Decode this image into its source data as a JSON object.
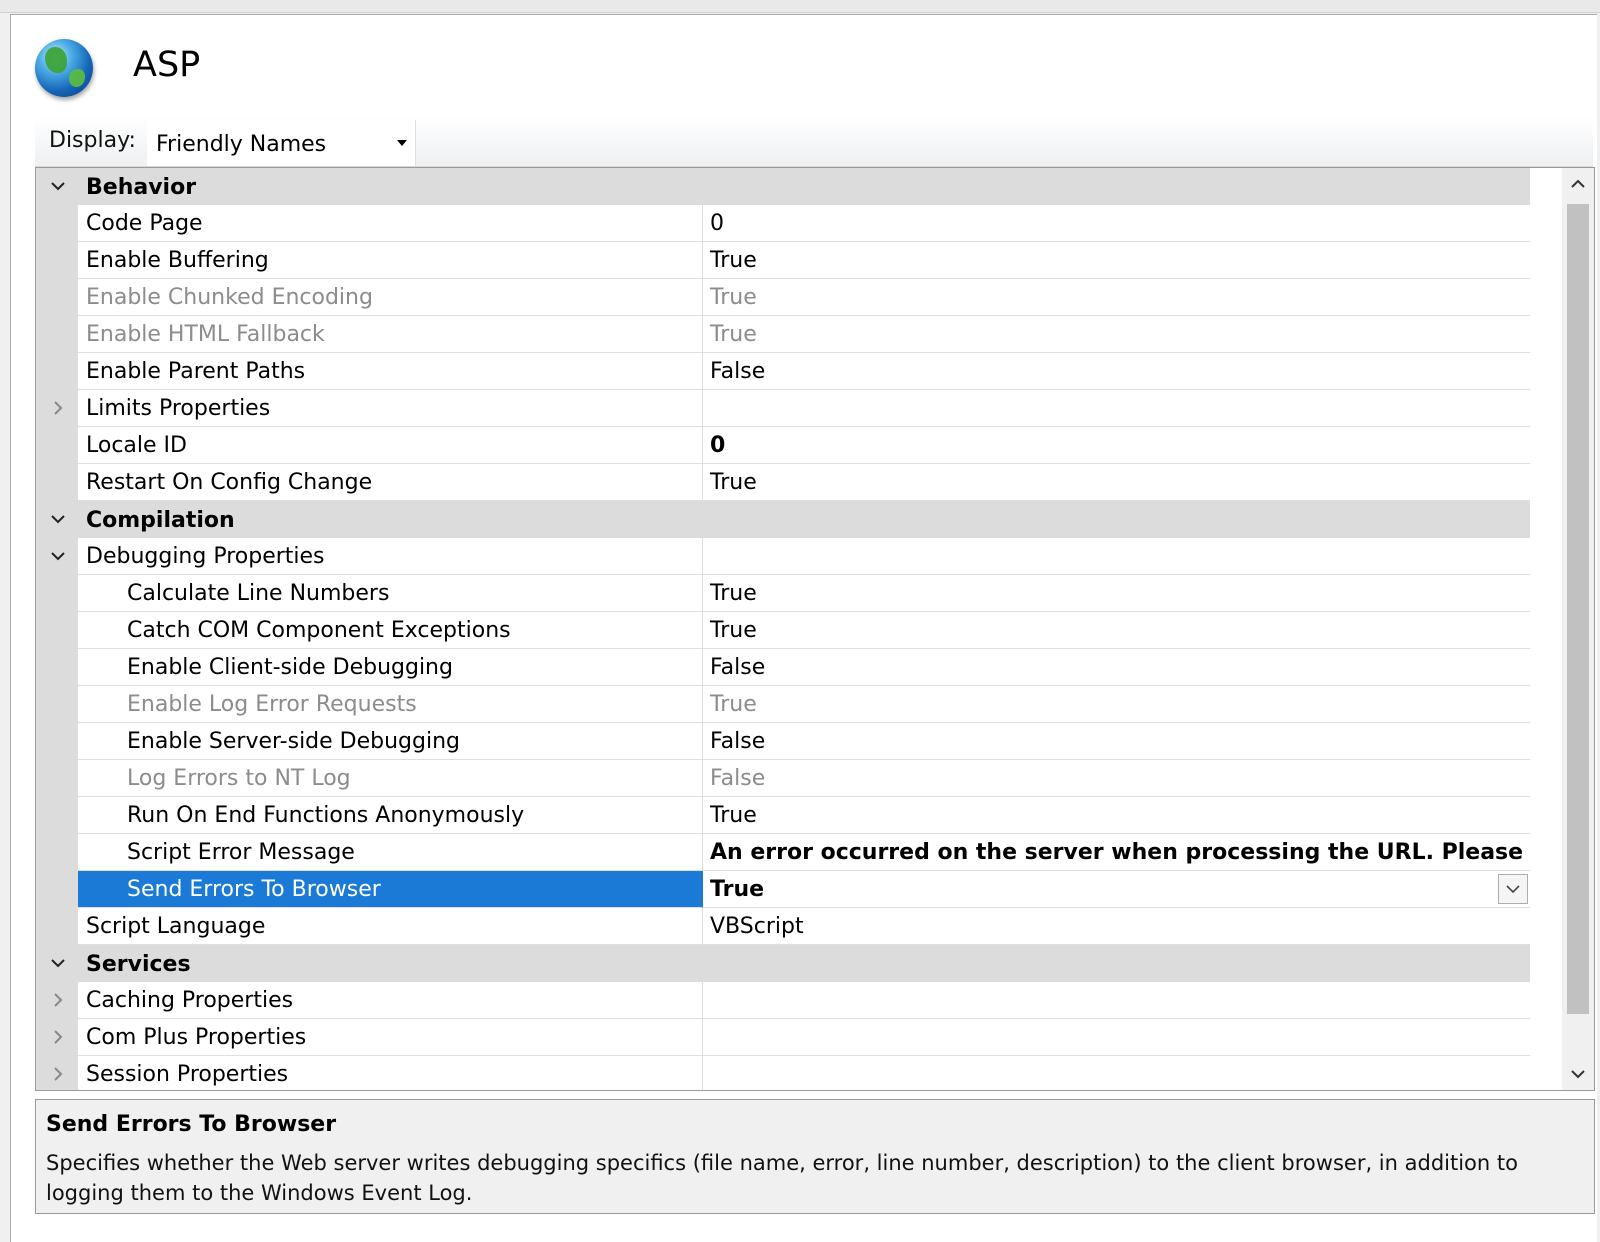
{
  "page": {
    "title": "ASP"
  },
  "toolbar": {
    "display_label": "Display:",
    "display_value": "Friendly Names"
  },
  "grid": {
    "rows": [
      {
        "type": "category",
        "label": "Behavior"
      },
      {
        "type": "property",
        "name": "Code Page",
        "value": "0"
      },
      {
        "type": "property",
        "name": "Enable Buffering",
        "value": "True"
      },
      {
        "type": "property",
        "name": "Enable Chunked Encoding",
        "value": "True",
        "disabled": true
      },
      {
        "type": "property",
        "name": "Enable HTML Fallback",
        "value": "True",
        "disabled": true
      },
      {
        "type": "property",
        "name": "Enable Parent Paths",
        "value": "False"
      },
      {
        "type": "property",
        "name": "Limits Properties",
        "value": "",
        "expandable": "collapsed"
      },
      {
        "type": "property",
        "name": "Locale ID",
        "value": "0",
        "bold": true
      },
      {
        "type": "property",
        "name": "Restart On Config Change",
        "value": "True"
      },
      {
        "type": "category",
        "label": "Compilation"
      },
      {
        "type": "property",
        "name": "Debugging Properties",
        "value": "",
        "expandable": "expanded"
      },
      {
        "type": "property",
        "name": "Calculate Line Numbers",
        "value": "True",
        "indent": 1
      },
      {
        "type": "property",
        "name": "Catch COM Component Exceptions",
        "value": "True",
        "indent": 1
      },
      {
        "type": "property",
        "name": "Enable Client-side Debugging",
        "value": "False",
        "indent": 1
      },
      {
        "type": "property",
        "name": "Enable Log Error Requests",
        "value": "True",
        "indent": 1,
        "disabled": true
      },
      {
        "type": "property",
        "name": "Enable Server-side Debugging",
        "value": "False",
        "indent": 1
      },
      {
        "type": "property",
        "name": "Log Errors to NT Log",
        "value": "False",
        "indent": 1,
        "disabled": true
      },
      {
        "type": "property",
        "name": "Run On End Functions Anonymously",
        "value": "True",
        "indent": 1
      },
      {
        "type": "property",
        "name": "Script Error Message",
        "value": "An error occurred on the server when processing the URL. Please contact t",
        "indent": 1,
        "bold": true
      },
      {
        "type": "property",
        "name": "Send Errors To Browser",
        "value": "True",
        "indent": 1,
        "bold": true,
        "selected": true
      },
      {
        "type": "property",
        "name": "Script Language",
        "value": "VBScript"
      },
      {
        "type": "category",
        "label": "Services"
      },
      {
        "type": "property",
        "name": "Caching Properties",
        "value": "",
        "expandable": "collapsed"
      },
      {
        "type": "property",
        "name": "Com Plus Properties",
        "value": "",
        "expandable": "collapsed"
      },
      {
        "type": "property",
        "name": "Session Properties",
        "value": "",
        "expandable": "collapsed"
      }
    ]
  },
  "description": {
    "title": "Send Errors To Browser",
    "text": "Specifies whether the Web server writes debugging specifics (file name, error, line number, description) to the client browser, in addition to logging them to the Windows Event Log."
  }
}
